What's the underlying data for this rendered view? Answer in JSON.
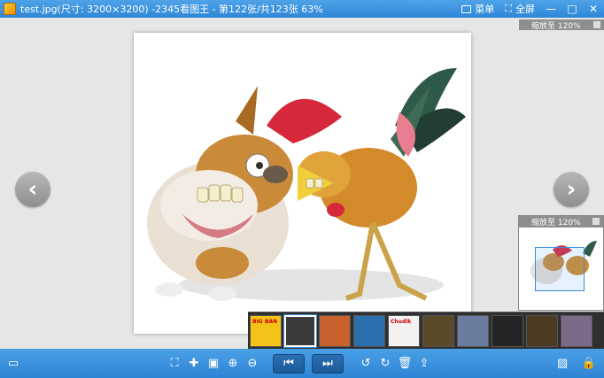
{
  "window": {
    "title": "test.jpg(尺寸: 3200×3200) -2345看图王 - 第122张/共123张 63%",
    "menu_label": "菜单",
    "fullscreen_label": "全屏",
    "minimize_glyph": "—",
    "maximize_glyph": "□",
    "close_glyph": "✕"
  },
  "viewer": {
    "zoom_label_top": "缩放至 120%",
    "navigator_label": "缩放至 120%",
    "prev_glyph": "‹",
    "next_glyph": "›"
  },
  "thumbnails": {
    "items": [
      {
        "name": "thumb-yellow-banner",
        "text": "BIG BAN",
        "bg": "#f3c417"
      },
      {
        "name": "thumb-phone-app",
        "text": "",
        "bg": "#3b3b3b",
        "selected": true
      },
      {
        "name": "thumb-colorful-grid",
        "text": "",
        "bg": "#c9612f"
      },
      {
        "name": "thumb-blue-screen",
        "text": "",
        "bg": "#2c6fae"
      },
      {
        "name": "thumb-chudik",
        "text": "Chudik",
        "bg": "#f2f2f2"
      },
      {
        "name": "thumb-dark-orange",
        "text": "",
        "bg": "#5b4a2a"
      },
      {
        "name": "thumb-landscape",
        "text": "",
        "bg": "#6a7d9e"
      },
      {
        "name": "thumb-dark-ui",
        "text": "",
        "bg": "#242424"
      },
      {
        "name": "thumb-orange-bar",
        "text": "",
        "bg": "#4c3b22"
      },
      {
        "name": "thumb-sunset",
        "text": "",
        "bg": "#7b6b88"
      }
    ]
  },
  "toolbar": {
    "prev_button_glyph": "⏮",
    "next_button_glyph": "⏭"
  }
}
